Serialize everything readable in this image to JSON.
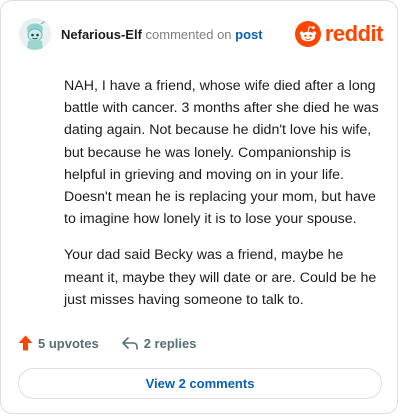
{
  "comment": {
    "username": "Nefarious-Elf",
    "action_text": "commented on",
    "target_text": "post",
    "paragraphs": [
      "NAH, I have a friend, whose wife died after a long battle with cancer. 3 months after she died he was dating again. Not because he didn't love his wife, but because he was lonely. Companionship is helpful in grieving and moving on in your life. Doesn't mean he is replacing your mom, but have to imagine how lonely it is to lose your spouse.",
      "Your dad said Becky was a friend, maybe he meant it, maybe they will date or are. Could be he just misses having someone to talk to."
    ],
    "upvotes_label": "5 upvotes",
    "replies_label": "2 replies",
    "view_comments_label": "View 2 comments"
  },
  "brand": {
    "wordmark": "reddit",
    "color": "#ff4500"
  },
  "icons": {
    "avatar": "snoo-avatar-icon",
    "logo": "reddit-logo-icon",
    "upvote": "upvote-arrow-icon",
    "reply": "reply-arrow-icon"
  },
  "colors": {
    "link": "#0a5fb4",
    "upvote": "#ff4500",
    "text": "#1c1c1c",
    "muted": "#576f76",
    "border": "#dcdfe3"
  }
}
